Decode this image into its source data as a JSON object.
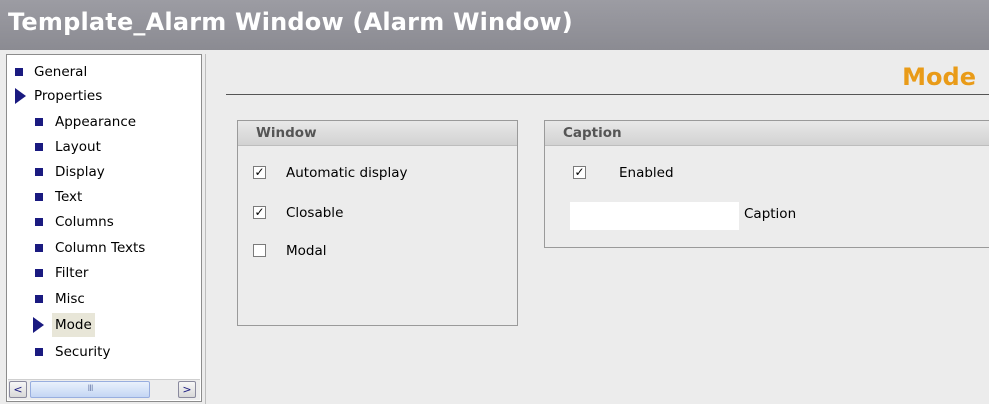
{
  "window": {
    "title": "Template_Alarm Window (Alarm Window)"
  },
  "nav": {
    "items": [
      {
        "label": "General",
        "level": 0,
        "marker": "bullet"
      },
      {
        "label": "Properties",
        "level": 0,
        "marker": "expanded-arrow"
      },
      {
        "label": "Appearance",
        "level": 1,
        "marker": "bullet"
      },
      {
        "label": "Layout",
        "level": 1,
        "marker": "bullet"
      },
      {
        "label": "Display",
        "level": 1,
        "marker": "bullet"
      },
      {
        "label": "Text",
        "level": 1,
        "marker": "bullet"
      },
      {
        "label": "Columns",
        "level": 1,
        "marker": "bullet"
      },
      {
        "label": "Column Texts",
        "level": 1,
        "marker": "bullet"
      },
      {
        "label": "Filter",
        "level": 1,
        "marker": "bullet"
      },
      {
        "label": "Misc",
        "level": 1,
        "marker": "bullet"
      },
      {
        "label": "Mode",
        "level": 1,
        "marker": "arrow",
        "selected": true
      },
      {
        "label": "Security",
        "level": 1,
        "marker": "bullet"
      }
    ],
    "scroll": {
      "left": "<",
      "right": ">",
      "thumb": "III"
    }
  },
  "content": {
    "heading": "Mode",
    "window_group": {
      "title": "Window",
      "options": [
        {
          "label": "Automatic display",
          "checked": true
        },
        {
          "label": "Closable",
          "checked": true
        },
        {
          "label": "Modal",
          "checked": false
        }
      ]
    },
    "caption_group": {
      "title": "Caption",
      "enabled": {
        "label": "Enabled",
        "checked": true
      },
      "caption_field": {
        "label": "Caption",
        "value": ""
      }
    }
  },
  "colors": {
    "title_bar": "#8b8b92",
    "heading": "#e99b18",
    "tree_marker": "#1a1a80",
    "selection": "#e8e6d8"
  }
}
